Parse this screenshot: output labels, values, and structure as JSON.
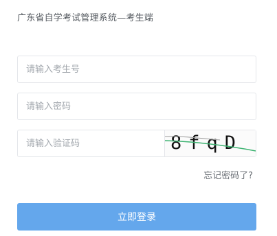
{
  "header": {
    "title": "广东省自学考试管理系统—考生端"
  },
  "form": {
    "username": {
      "placeholder": "请输入考生号",
      "value": ""
    },
    "password": {
      "placeholder": "请输入密码",
      "value": ""
    },
    "captcha": {
      "placeholder": "请输入验证码",
      "value": "",
      "image_text": "8fqD"
    },
    "forgot_label": "忘记密码了?",
    "login_label": "立即登录"
  },
  "colors": {
    "accent": "#64a7ec",
    "border": "#e4e6ea",
    "captcha_line": "#3cb371"
  },
  "icons": {
    "captcha": "captcha-image"
  }
}
